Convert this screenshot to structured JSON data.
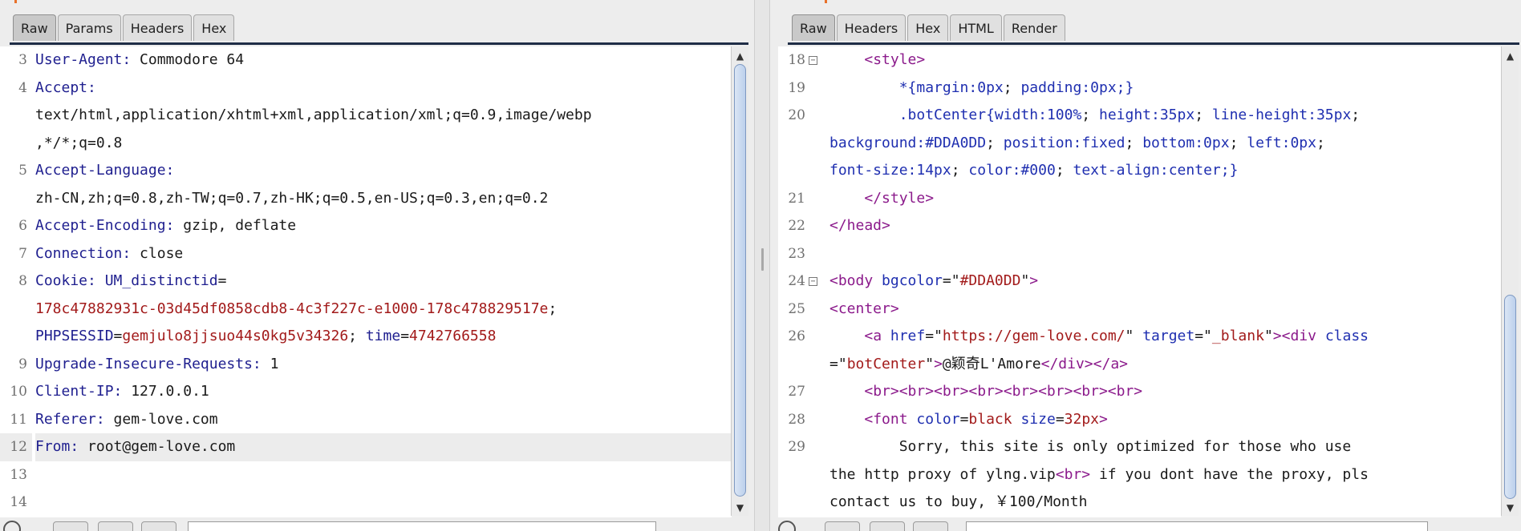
{
  "request": {
    "tabs": [
      {
        "label": "Raw",
        "active": true
      },
      {
        "label": "Params"
      },
      {
        "label": "Headers"
      },
      {
        "label": "Hex"
      }
    ],
    "lines": [
      {
        "n": "3",
        "parts": [
          {
            "t": "User-Agent:",
            "c": "k"
          },
          {
            "t": " Commodore 64"
          }
        ]
      },
      {
        "n": "4",
        "parts": [
          {
            "t": "Accept:",
            "c": "k"
          }
        ]
      },
      {
        "n": "",
        "parts": [
          {
            "t": "text/html,application/xhtml+xml,application/xml;q=0.9,image/webp"
          }
        ]
      },
      {
        "n": "",
        "parts": [
          {
            "t": ",*/*;q=0.8"
          }
        ]
      },
      {
        "n": "5",
        "parts": [
          {
            "t": "Accept-Language:",
            "c": "k"
          }
        ]
      },
      {
        "n": "",
        "parts": [
          {
            "t": "zh-CN,zh;q=0.8,zh-TW;q=0.7,zh-HK;q=0.5,en-US;q=0.3,en;q=0.2"
          }
        ]
      },
      {
        "n": "6",
        "parts": [
          {
            "t": "Accept-Encoding:",
            "c": "k"
          },
          {
            "t": " gzip, deflate"
          }
        ]
      },
      {
        "n": "7",
        "parts": [
          {
            "t": "Connection:",
            "c": "k"
          },
          {
            "t": " close"
          }
        ]
      },
      {
        "n": "8",
        "parts": [
          {
            "t": "Cookie:",
            "c": "k"
          },
          {
            "t": " "
          },
          {
            "t": "UM_distinctid",
            "c": "ckn"
          },
          {
            "t": "="
          }
        ]
      },
      {
        "n": "",
        "parts": [
          {
            "t": "178c47882931c-03d45df0858cdb8-4c3f227c-e1000-178c478829517e",
            "c": "ckv"
          },
          {
            "t": ";"
          }
        ]
      },
      {
        "n": "",
        "parts": [
          {
            "t": "PHPSESSID",
            "c": "ckn"
          },
          {
            "t": "="
          },
          {
            "t": "gemjulo8jjsuo44s0kg5v34326",
            "c": "ckv"
          },
          {
            "t": "; "
          },
          {
            "t": "time",
            "c": "ckn"
          },
          {
            "t": "="
          },
          {
            "t": "4742766558",
            "c": "ckv"
          }
        ]
      },
      {
        "n": "9",
        "parts": [
          {
            "t": "Upgrade-Insecure-Requests:",
            "c": "k"
          },
          {
            "t": " 1"
          }
        ]
      },
      {
        "n": "10",
        "parts": [
          {
            "t": "Client-IP:",
            "c": "k"
          },
          {
            "t": " 127.0.0.1"
          }
        ]
      },
      {
        "n": "11",
        "parts": [
          {
            "t": "Referer:",
            "c": "k"
          },
          {
            "t": " gem-love.com"
          }
        ]
      },
      {
        "n": "12",
        "hl": true,
        "parts": [
          {
            "t": "From:",
            "c": "k"
          },
          {
            "t": " root@gem-love.com"
          }
        ]
      },
      {
        "n": "13",
        "parts": []
      },
      {
        "n": "14",
        "parts": []
      }
    ]
  },
  "response": {
    "tabs": [
      {
        "label": "Raw",
        "active": true
      },
      {
        "label": "Headers"
      },
      {
        "label": "Hex"
      },
      {
        "label": "HTML"
      },
      {
        "label": "Render"
      }
    ],
    "lines": [
      {
        "n": "18",
        "fold": true,
        "parts": [
          {
            "t": "    "
          },
          {
            "t": "<style>",
            "c": "tg"
          }
        ]
      },
      {
        "n": "19",
        "parts": [
          {
            "t": "        "
          },
          {
            "t": "*{margin:",
            "c": "cs"
          },
          {
            "t": "0px",
            "c": "cs"
          },
          {
            "t": "; "
          },
          {
            "t": "padding:",
            "c": "cs"
          },
          {
            "t": "0px",
            "c": "cs"
          },
          {
            "t": ";}",
            "c": "cs"
          }
        ]
      },
      {
        "n": "20",
        "parts": [
          {
            "t": "        "
          },
          {
            "t": ".botCenter{width:",
            "c": "cs"
          },
          {
            "t": "100%",
            "c": "cs"
          },
          {
            "t": "; "
          },
          {
            "t": "height:",
            "c": "cs"
          },
          {
            "t": "35px",
            "c": "cs"
          },
          {
            "t": "; "
          },
          {
            "t": "line-height:",
            "c": "cs"
          },
          {
            "t": "35px",
            "c": "cs"
          },
          {
            "t": ";"
          }
        ]
      },
      {
        "n": "",
        "parts": [
          {
            "t": "background:",
            "c": "cs"
          },
          {
            "t": "#DDA0DD",
            "c": "cs"
          },
          {
            "t": "; "
          },
          {
            "t": "position:",
            "c": "cs"
          },
          {
            "t": "fixed",
            "c": "cs"
          },
          {
            "t": "; "
          },
          {
            "t": "bottom:",
            "c": "cs"
          },
          {
            "t": "0px",
            "c": "cs"
          },
          {
            "t": "; "
          },
          {
            "t": "left:",
            "c": "cs"
          },
          {
            "t": "0px",
            "c": "cs"
          },
          {
            "t": ";"
          }
        ]
      },
      {
        "n": "",
        "parts": [
          {
            "t": "font-size:",
            "c": "cs"
          },
          {
            "t": "14px",
            "c": "cs"
          },
          {
            "t": "; "
          },
          {
            "t": "color:",
            "c": "cs"
          },
          {
            "t": "#000",
            "c": "cs"
          },
          {
            "t": "; "
          },
          {
            "t": "text-align:",
            "c": "cs"
          },
          {
            "t": "center",
            "c": "cs"
          },
          {
            "t": ";}",
            "c": "cs"
          }
        ]
      },
      {
        "n": "21",
        "parts": [
          {
            "t": "    "
          },
          {
            "t": "</style>",
            "c": "tg"
          }
        ]
      },
      {
        "n": "22",
        "parts": [
          {
            "t": "</head>",
            "c": "tg"
          }
        ]
      },
      {
        "n": "23",
        "parts": []
      },
      {
        "n": "24",
        "fold": true,
        "parts": [
          {
            "t": "<body ",
            "c": "tg"
          },
          {
            "t": "bgcolor",
            "c": "at"
          },
          {
            "t": "=\""
          },
          {
            "t": "#DDA0DD",
            "c": "av"
          },
          {
            "t": "\""
          },
          {
            "t": ">",
            "c": "tg"
          }
        ]
      },
      {
        "n": "25",
        "parts": [
          {
            "t": "<center>",
            "c": "tg"
          }
        ]
      },
      {
        "n": "26",
        "parts": [
          {
            "t": "    "
          },
          {
            "t": "<a ",
            "c": "tg"
          },
          {
            "t": "href",
            "c": "at"
          },
          {
            "t": "=\""
          },
          {
            "t": "https://gem-love.com/",
            "c": "av"
          },
          {
            "t": "\" "
          },
          {
            "t": "target",
            "c": "at"
          },
          {
            "t": "=\""
          },
          {
            "t": "_blank",
            "c": "av"
          },
          {
            "t": "\""
          },
          {
            "t": ">",
            "c": "tg"
          },
          {
            "t": "<div ",
            "c": "tg"
          },
          {
            "t": "class",
            "c": "at"
          }
        ]
      },
      {
        "n": "",
        "parts": [
          {
            "t": "=\""
          },
          {
            "t": "botCenter",
            "c": "av"
          },
          {
            "t": "\""
          },
          {
            "t": ">",
            "c": "tg"
          },
          {
            "t": "@颖奇L'Amore"
          },
          {
            "t": "</div></a>",
            "c": "tg"
          }
        ]
      },
      {
        "n": "27",
        "parts": [
          {
            "t": "    "
          },
          {
            "t": "<br><br><br><br><br><br><br><br>",
            "c": "tg"
          }
        ]
      },
      {
        "n": "28",
        "parts": [
          {
            "t": "    "
          },
          {
            "t": "<font ",
            "c": "tg"
          },
          {
            "t": "color",
            "c": "at"
          },
          {
            "t": "="
          },
          {
            "t": "black",
            "c": "av"
          },
          {
            "t": " "
          },
          {
            "t": "size",
            "c": "at"
          },
          {
            "t": "="
          },
          {
            "t": "32px",
            "c": "av"
          },
          {
            "t": ">",
            "c": "tg"
          }
        ]
      },
      {
        "n": "29",
        "parts": [
          {
            "t": "        Sorry, this site is only optimized for those who use"
          }
        ]
      },
      {
        "n": "",
        "parts": [
          {
            "t": "the http proxy of ylng.vip"
          },
          {
            "t": "<br>",
            "c": "tg"
          },
          {
            "t": " if you dont have the proxy, pls"
          }
        ]
      },
      {
        "n": "",
        "parts": [
          {
            "t": "contact us to buy, ￥100/Month"
          }
        ]
      }
    ]
  }
}
